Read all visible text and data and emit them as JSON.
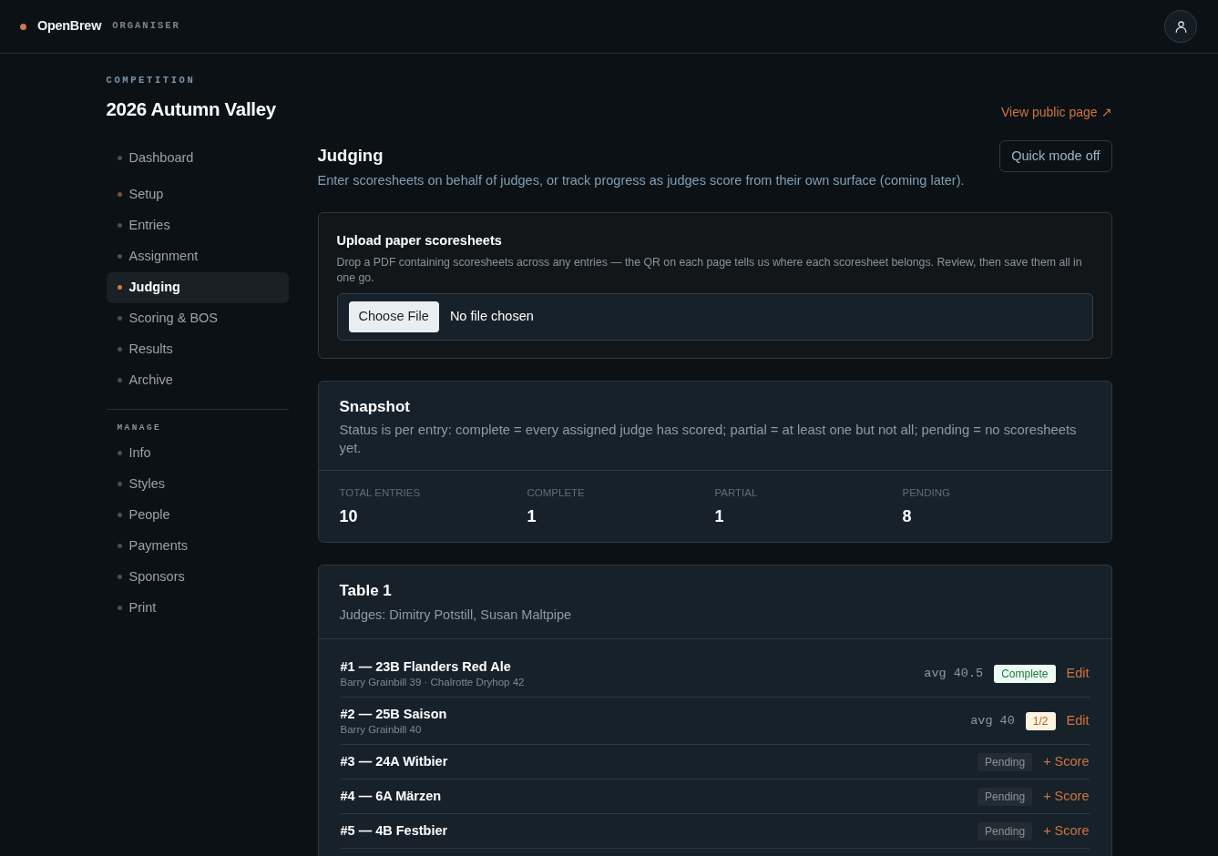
{
  "topbar": {
    "brand": "OpenBrew",
    "role": "ORGANISER"
  },
  "competition": {
    "eyebrow": "COMPETITION",
    "title": "2026 Autumn Valley",
    "public_link": "View public page ↗"
  },
  "sidebar": {
    "sections": [
      {
        "items": [
          {
            "label": "Dashboard",
            "selected": false,
            "color": "#474f55"
          }
        ]
      },
      {
        "items": [
          {
            "label": "Setup",
            "selected": false,
            "color": "#7d5137"
          },
          {
            "label": "Entries",
            "selected": false,
            "color": "#474f55"
          },
          {
            "label": "Assignment",
            "selected": false,
            "color": "#474f55"
          },
          {
            "label": "Judging",
            "selected": true,
            "color": "#d17a47"
          },
          {
            "label": "Scoring & BOS",
            "selected": false,
            "color": "#474f55"
          },
          {
            "label": "Results",
            "selected": false,
            "color": "#474f55"
          },
          {
            "label": "Archive",
            "selected": false,
            "color": "#474f55"
          }
        ]
      },
      {
        "heading": "MANAGE",
        "items": [
          {
            "label": "Info",
            "selected": false,
            "color": "#474f55"
          },
          {
            "label": "Styles",
            "selected": false,
            "color": "#474f55"
          },
          {
            "label": "People",
            "selected": false,
            "color": "#474f55"
          },
          {
            "label": "Payments",
            "selected": false,
            "color": "#474f55"
          },
          {
            "label": "Sponsors",
            "selected": false,
            "color": "#474f55"
          },
          {
            "label": "Print",
            "selected": false,
            "color": "#474f55"
          }
        ]
      }
    ]
  },
  "page": {
    "title": "Judging",
    "subtitle": "Enter scoresheets on behalf of judges, or track progress as judges score from their own surface (coming later).",
    "quick_mode_button": "Quick mode off"
  },
  "upload": {
    "title": "Upload paper scoresheets",
    "description": "Drop a PDF containing scoresheets across any entries — the QR on each page tells us where each scoresheet belongs. Review, then save them all in one go.",
    "choose_button": "Choose File",
    "file_status": "No file chosen"
  },
  "snapshot": {
    "title": "Snapshot",
    "description": "Status is per entry: complete = every assigned judge has scored; partial = at least one but not all; pending = no scoresheets yet.",
    "stats": [
      {
        "label": "TOTAL ENTRIES",
        "value": "10"
      },
      {
        "label": "COMPLETE",
        "value": "1"
      },
      {
        "label": "PARTIAL",
        "value": "1"
      },
      {
        "label": "PENDING",
        "value": "8"
      }
    ]
  },
  "tables": [
    {
      "title": "Table 1",
      "judges": "Judges: Dimitry Potstill, Susan Maltpipe",
      "entries": [
        {
          "title": "#1 — 23B Flanders Red Ale",
          "scores": "Barry Grainbill 39 · Chalrotte Dryhop 42",
          "average": "avg 40.5",
          "status": {
            "kind": "complete",
            "label": "Complete"
          },
          "action": "Edit"
        },
        {
          "title": "#2 — 25B Saison",
          "scores": "Barry Grainbill 40",
          "average": "avg 40",
          "status": {
            "kind": "partial",
            "label": "1/2"
          },
          "action": "Edit"
        },
        {
          "title": "#3 — 24A Witbier",
          "status": {
            "kind": "pending",
            "label": "Pending"
          },
          "action": "+ Score"
        },
        {
          "title": "#4 — 6A Märzen",
          "status": {
            "kind": "pending",
            "label": "Pending"
          },
          "action": "+ Score"
        },
        {
          "title": "#5 — 4B Festbier",
          "status": {
            "kind": "pending",
            "label": "Pending"
          },
          "action": "+ Score"
        }
      ]
    }
  ]
}
